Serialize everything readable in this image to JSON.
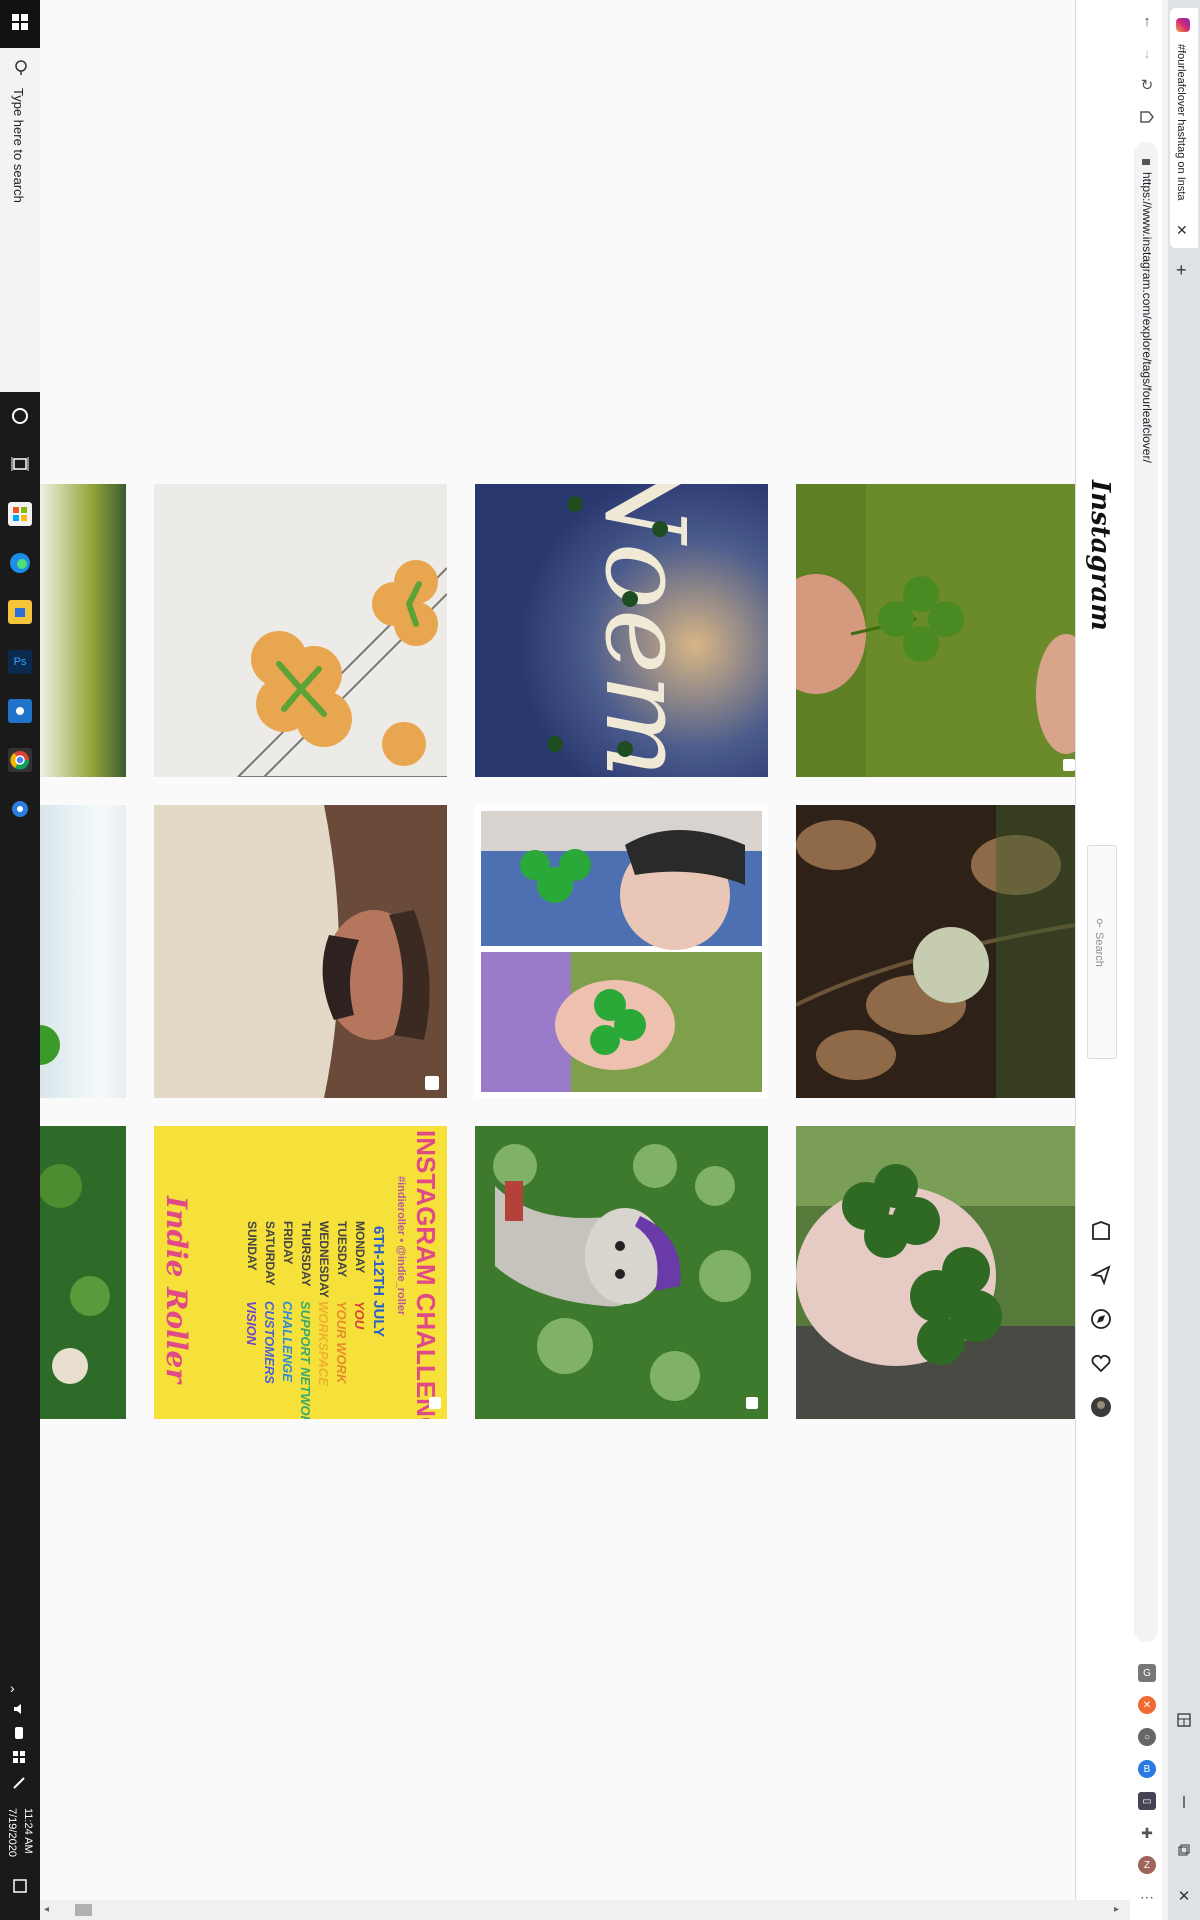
{
  "taskbar": {
    "search_placeholder": "Type here to search",
    "time": "11:24 AM",
    "date": "7/19/2020"
  },
  "browser": {
    "tab_title": "#fourleafclover hashtag on Insta",
    "url": "https://www.instagram.com/explore/tags/fourleafclover/"
  },
  "instagram": {
    "logo": "Instagram",
    "search_placeholder": "Search"
  },
  "posts": [
    {
      "desc": "clover cookies",
      "colors": [
        "#ecebe7",
        "#e7a44a",
        "#6bb03a"
      ]
    },
    {
      "desc": "Noemi sign",
      "colors": [
        "#2e3d72",
        "#ddd8c6",
        "#9c8d6c"
      ]
    },
    {
      "desc": "hand with clover",
      "colors": [
        "#6e8d2c",
        "#d99a80",
        "#4a7a1b"
      ]
    },
    {
      "desc": "man portrait",
      "colors": [
        "#6b4b3a",
        "#e5dccb",
        "#302420"
      ]
    },
    {
      "desc": "girl with clover",
      "colors": [
        "#4c6fb2",
        "#e8c5b5",
        "#2a9d34"
      ]
    },
    {
      "desc": "tomato plant",
      "colors": [
        "#3d2a1c",
        "#9d7a56",
        "#c8d0b0"
      ]
    },
    {
      "desc": "challenge poster",
      "colors": [
        "#f5e13a",
        "#e04a86",
        "#3b7bd8"
      ]
    },
    {
      "desc": "doll in clover",
      "colors": [
        "#3f7a2f",
        "#8fb56e",
        "#c0bdb6"
      ]
    },
    {
      "desc": "hand holding clovers",
      "colors": [
        "#3c6b2c",
        "#e0c7c0",
        "#2a4a25"
      ]
    }
  ],
  "poster_text": {
    "title": "INSTAGRAM CHALLENGE",
    "dates": "6TH-12TH JULY",
    "tags": "#indieroller • @indie_roller",
    "days": [
      "MONDAY",
      "TUESDAY",
      "WEDNESDAY",
      "THURSDAY",
      "FRIDAY",
      "SATURDAY",
      "SUNDAY"
    ],
    "themes": [
      "YOU",
      "YOUR WORK",
      "WORKSPACE",
      "SUPPORT NETWORK",
      "CHALLENGE",
      "CUSTOMERS",
      "VISION"
    ],
    "brand": "Indie Roller"
  },
  "sign_text": "Noemi",
  "colors": {
    "taskbar": "#1a1a1a",
    "page": "#fafafa",
    "ig_border": "#dbdbdb"
  }
}
